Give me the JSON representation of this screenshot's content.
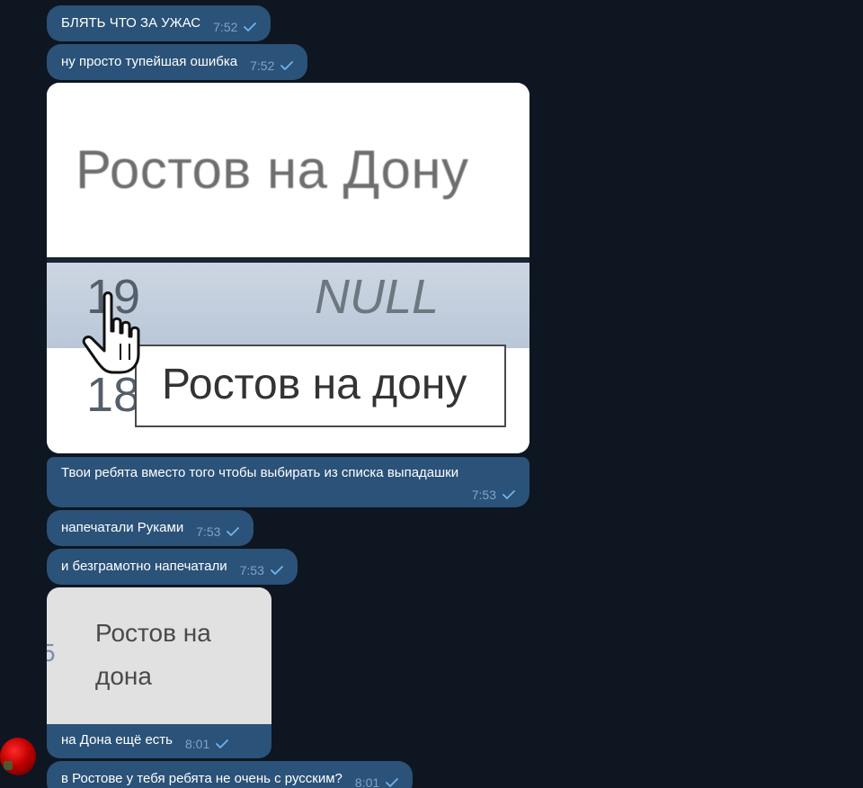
{
  "colors": {
    "background": "#0e1621",
    "bubble": "#2b5278",
    "meta_text": "#7fa4c6",
    "check": "#6fb4f0"
  },
  "messages": [
    {
      "text": "БЛЯТЬ ЧТО ЗА УЖАС",
      "time": "7:52"
    },
    {
      "text": "ну просто тупейшая ошибка",
      "time": "7:52"
    },
    {
      "text": "Твои ребята вместо того чтобы выбирать из списка выпадашки",
      "time": "7:53"
    },
    {
      "text": "напечатали Руками",
      "time": "7:53"
    },
    {
      "text": "и безграмотно напечатали",
      "time": "7:53"
    },
    {
      "text": "на Дона ещё  есть",
      "time": "8:01"
    },
    {
      "text": "в Ростове у тебя ребята не очень с русским?",
      "time": "8:01"
    }
  ],
  "photo1": {
    "top_text": "Ростов на Дону",
    "row_number_1": "19",
    "null_text": "NULL",
    "row_number_2": "18",
    "tooltip_text": "Ростов на дону"
  },
  "photo2": {
    "prefix": "5",
    "line1": "Ростов на",
    "line2": "дона"
  },
  "icons": {
    "read_check": "check-icon",
    "cursor": "hand-cursor-icon",
    "avatar": "user-avatar"
  }
}
